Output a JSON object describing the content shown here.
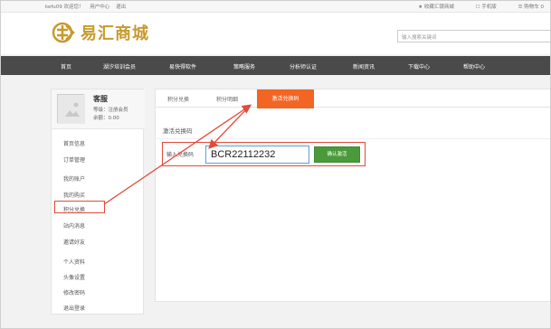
{
  "topbar": {
    "user": "kefu09 欢迎您！",
    "user_center": "用户中心",
    "logout": "退出",
    "favorite": "★ 收藏汇银商城",
    "mobile": "☐ 手机版",
    "cart": "☰ 购物车 0"
  },
  "header": {
    "logo_text": "易汇商城",
    "search_placeholder": "输入搜索关键词"
  },
  "nav": {
    "items": [
      "首页",
      "湖汐培训会员",
      "易快得软件",
      "策略服务",
      "分析师认证",
      "新闻资讯",
      "下载中心",
      "帮助中心"
    ]
  },
  "sidebar": {
    "name": "客服",
    "level": "等级：注册会员",
    "balance": "余额：0.00",
    "links": [
      "首页信息",
      "订单管理",
      "我的账户",
      "我的购买",
      "积分兑换",
      "站内消息",
      "邀请好友",
      "个人资料",
      "头像设置",
      "修改密码",
      "退出登录"
    ],
    "active": "积分兑换"
  },
  "main": {
    "tabs": [
      "积分兑换",
      "积分明细",
      "激活兑换码"
    ],
    "section_title": "激活兑换码",
    "redeem_label": "输入兑换码",
    "redeem_value": "BCR22112232",
    "redeem_button": "确认激活"
  },
  "colors": {
    "accent": "#f26522",
    "nav_bg": "#4a4a4a",
    "button_green": "#4a9a3c",
    "highlight_red": "#e34a3a",
    "logo_gold": "#c89a2e"
  }
}
